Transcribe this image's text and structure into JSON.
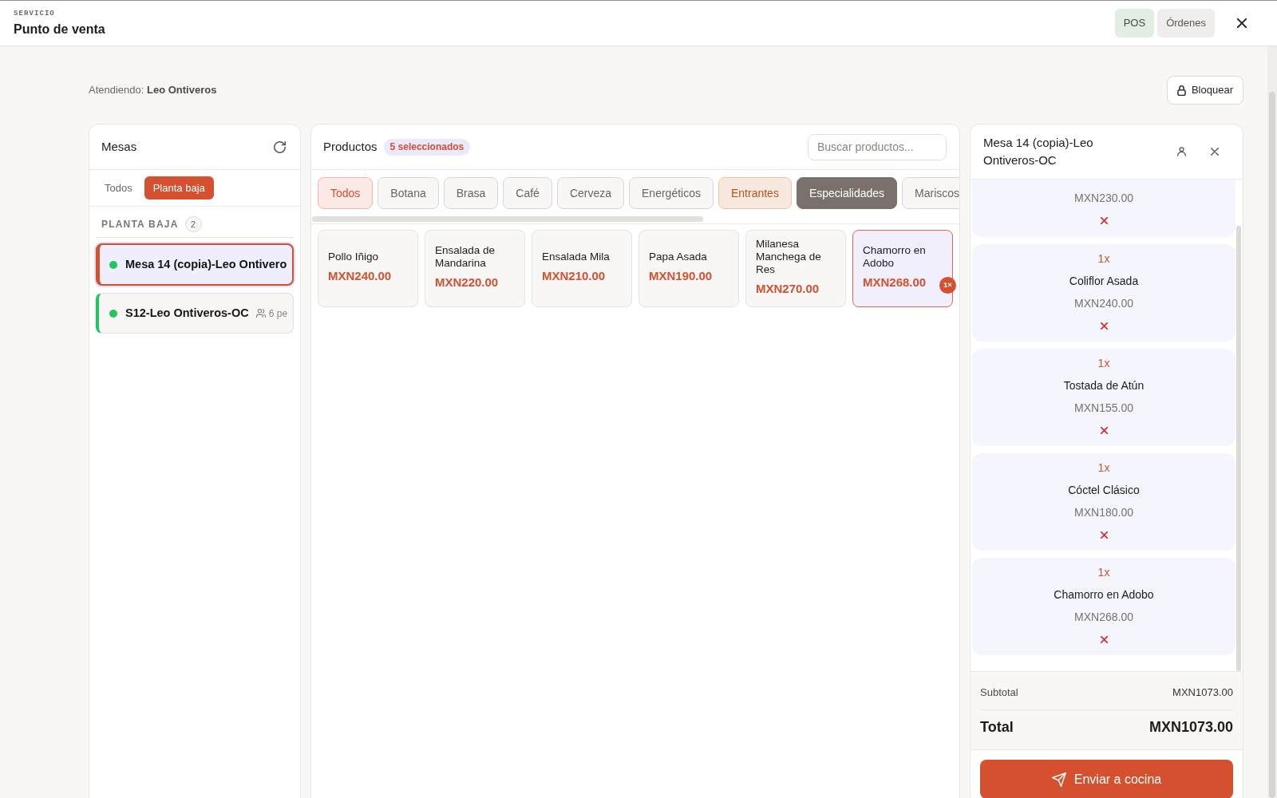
{
  "header": {
    "eyebrow": "SERVICIO",
    "title": "Punto de venta",
    "tabs": [
      {
        "label": "POS",
        "selected": true
      },
      {
        "label": "Órdenes",
        "selected": false
      }
    ]
  },
  "attending": "Atendiendo: **Leo Ontiveros**",
  "lock_button": "Bloquear",
  "tables_panel": {
    "title": "Mesas",
    "filters": [
      {
        "label": "Todos",
        "selected": false
      },
      {
        "label": "Planta baja",
        "selected": true
      }
    ],
    "section": {
      "title": "PLANTA BAJA",
      "count": "2"
    },
    "tables": [
      {
        "name": "Mesa 14 (copia)-Leo Ontivero",
        "color": "#22c55e",
        "selected": true
      },
      {
        "name": "S12-Leo Ontiveros-OC",
        "color": "#22c55e",
        "selected": false,
        "guests": "6 pe"
      }
    ]
  },
  "products_panel": {
    "title": "Productos",
    "badge": "5 seleccionados",
    "search": {
      "placeholder": "Buscar productos..."
    },
    "categories": [
      {
        "label": "Todos",
        "kind": "all",
        "selected": false,
        "has_items": false
      },
      {
        "label": "Botana",
        "kind": "category",
        "selected": false,
        "has_items": false
      },
      {
        "label": "Brasa",
        "kind": "category",
        "selected": false,
        "has_items": false
      },
      {
        "label": "Café",
        "kind": "category",
        "selected": false,
        "has_items": false
      },
      {
        "label": "Cerveza",
        "kind": "category",
        "selected": false,
        "has_items": false
      },
      {
        "label": "Energéticos",
        "kind": "category",
        "selected": false,
        "has_items": false
      },
      {
        "label": "Entrantes",
        "kind": "category",
        "selected": false,
        "has_items": true
      },
      {
        "label": "Especialidades",
        "kind": "category",
        "selected": true
      },
      {
        "label": "Mariscos",
        "kind": "category",
        "selected": false,
        "has_items": false
      }
    ],
    "products": [
      {
        "name": "Pollo Iñigo",
        "price": "MXN240.00",
        "selected": false
      },
      {
        "name": "Ensalada de Mandarina",
        "price": "MXN220.00",
        "selected": false
      },
      {
        "name": "Ensalada Mila",
        "price": "MXN210.00",
        "selected": false
      },
      {
        "name": "Papa Asada",
        "price": "MXN190.00",
        "selected": false
      },
      {
        "name": "Milanesa Manchega de Res",
        "price": "MXN270.00",
        "selected": false
      },
      {
        "name": "Chamorro en Adobo",
        "price": "MXN268.00",
        "selected": true,
        "badge": "1×"
      }
    ]
  },
  "order_panel": {
    "title": "Mesa 14 (copia)-Leo Ontiveros-OC",
    "items": [
      {
        "price": "MXN230.00"
      },
      {
        "quantity": "1x",
        "name": "Coliflor Asada",
        "price": "MXN240.00"
      },
      {
        "quantity": "1x",
        "name": "Tostada de Atún",
        "price": "MXN155.00"
      },
      {
        "quantity": "1x",
        "name": "Cóctel Clásico",
        "price": "MXN180.00"
      },
      {
        "quantity": "1x",
        "name": "Chamorro en Adobo",
        "price": "MXN268.00"
      }
    ],
    "subtotal": {
      "label": "Subtotal",
      "value": "MXN1073.00"
    },
    "total": {
      "label": "Total",
      "value": "MXN1073.00"
    },
    "send_button": "Enviar a cocina"
  }
}
